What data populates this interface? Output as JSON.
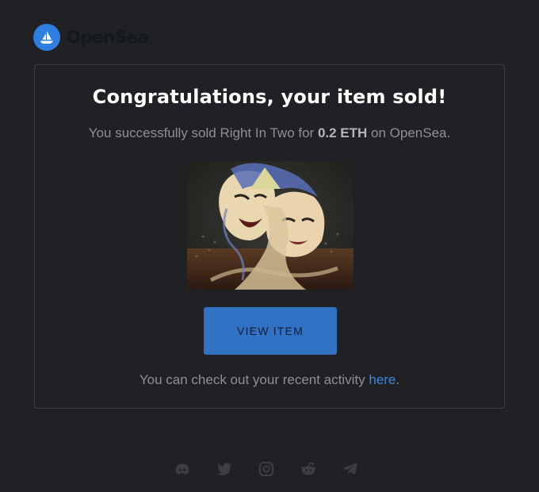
{
  "brand": {
    "name": "OpenSea",
    "logo_icon": "opensea-boat-icon",
    "logo_color": "#2f7fe0"
  },
  "email": {
    "heading": "Congratulations, your item sold!",
    "sold_prefix": "You successfully sold Right In Two for ",
    "sold_price": "0.2 ETH",
    "sold_suffix": " on OpenSea.",
    "item_image_icon": "nft-artwork-image",
    "view_button_label": "VIEW ITEM",
    "activity_prefix": "You can check out your recent activity ",
    "activity_link": "here",
    "activity_suffix": "."
  },
  "footer": {
    "social_icons": [
      "discord-icon",
      "twitter-icon",
      "instagram-icon",
      "reddit-icon",
      "telegram-icon"
    ]
  },
  "colors": {
    "background": "#202124",
    "accent": "#3172c4",
    "link": "#3d86dc"
  }
}
